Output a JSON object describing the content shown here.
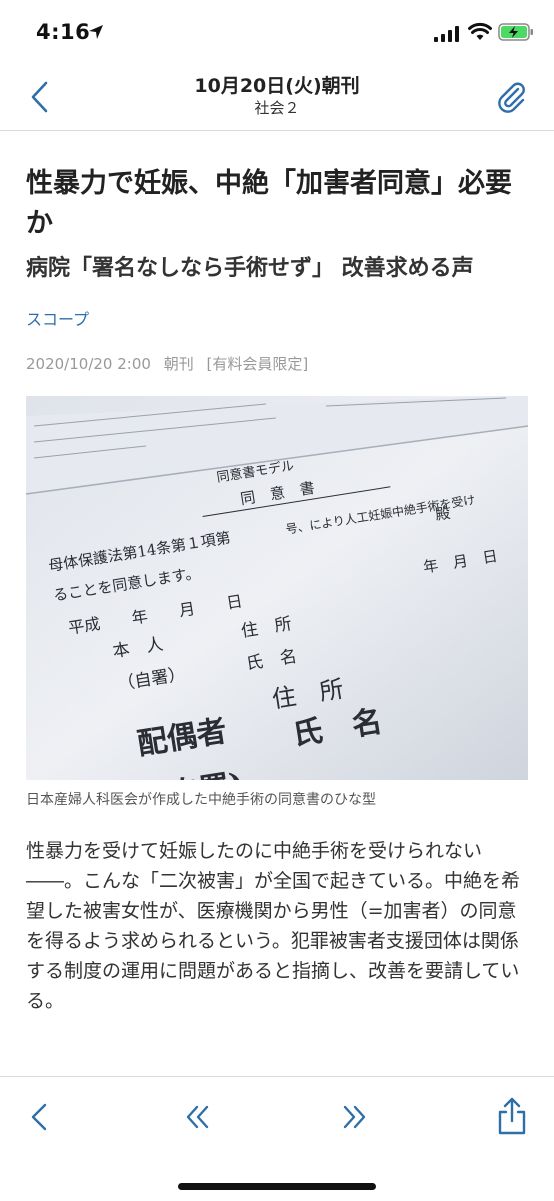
{
  "status_bar": {
    "time": "4:16",
    "icons": [
      "location-arrow-icon",
      "cellular-signal-icon",
      "wifi-icon",
      "battery-charging-icon"
    ]
  },
  "nav": {
    "title": "10月20日(火)朝刊",
    "subtitle": "社会２",
    "back_icon": "chevron-left-icon",
    "right_icon": "paperclip-icon"
  },
  "article": {
    "headline": "性暴力で妊娠、中絶「加害者同意」必要か",
    "subheadline": "病院「署名なしなら手術せず」 改善求める声",
    "tag": "スコープ",
    "meta": {
      "datetime": "2020/10/20 2:00",
      "edition": "朝刊",
      "access": "[有料会員限定]"
    },
    "photo": {
      "form_title": "同意書モデル",
      "form_heading": "同　意　書",
      "line1": "母体保護法第14条第１項第",
      "line1b": "号、により人工妊娠中絶手術を受け",
      "line2": "ることを同意します。",
      "date_row": "平成　　年　　月　　日",
      "person": "本　人",
      "address": "住　所",
      "name": "氏　名",
      "sign": "（自署）",
      "spouse": "配偶者",
      "spouse_address": "住　所",
      "spouse_name": "氏　名",
      "spouse_sign": "(自署)",
      "right_marker": "殿",
      "right_date": "年　月　日"
    },
    "caption": "日本産婦人科医会が作成した中絶手術の同意書のひな型",
    "body": "性暴力を受けて妊娠したのに中絶手術を受けられない――。こんな「二次被害」が全国で起きている。中絶を希望した被害女性が、医療機関から男性（=加害者）の同意を得るよう求められるという。犯罪被害者支援団体は関係する制度の運用に問題があると指摘し、改善を要請している。"
  },
  "toolbar": {
    "icons": [
      "back-icon",
      "previous-article-icon",
      "next-article-icon",
      "share-icon"
    ]
  },
  "colors": {
    "accent": "#2f6fa8",
    "meta_gray": "#999999",
    "divider": "#d9d9d9"
  }
}
